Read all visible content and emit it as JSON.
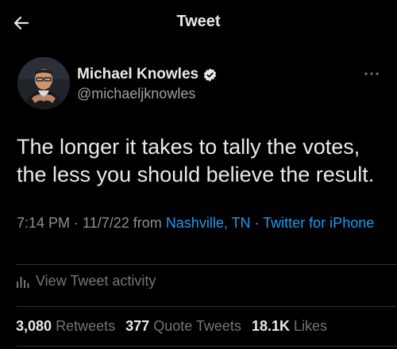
{
  "header": {
    "title": "Tweet",
    "back_icon": "arrow-left-icon"
  },
  "author": {
    "name": "Michael Knowles",
    "handle": "@michaeljknowles",
    "verified_icon": "verified-badge-icon"
  },
  "more_icon": "more-horizontal-icon",
  "tweet": {
    "text": "The longer it takes to tally the votes, the less you should believe the result."
  },
  "meta": {
    "time": "7:14 PM",
    "sep1": " · ",
    "date": "11/7/22",
    "from": " from ",
    "location": "Nashville, TN",
    "sep2": " · ",
    "source": "Twitter for iPhone"
  },
  "activity": {
    "icon": "analytics-bars-icon",
    "label": "View Tweet activity"
  },
  "stats": {
    "retweets_count": "3,080",
    "retweets_label": "Retweets",
    "quotes_count": "377",
    "quotes_label": "Quote Tweets",
    "likes_count": "18.1K",
    "likes_label": "Likes"
  },
  "colors": {
    "background": "#000000",
    "link": "#1d9bf0",
    "secondary_text": "#71767b",
    "divider": "#2f3336"
  }
}
